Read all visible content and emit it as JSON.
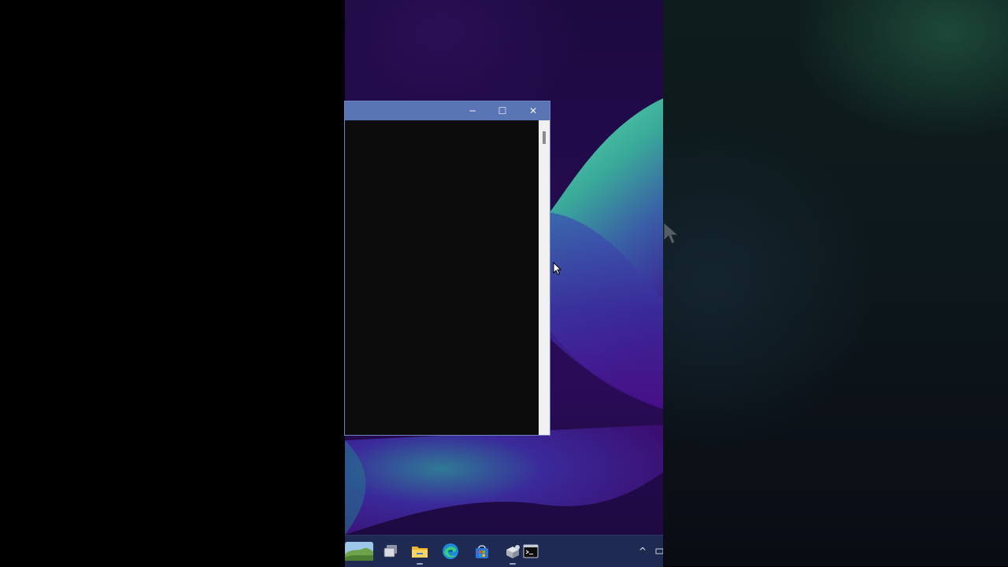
{
  "window": {
    "title": "",
    "minimize_glyph": "─",
    "maximize_glyph": "☐",
    "close_glyph": "✕",
    "console_text": ""
  },
  "taskbar": {
    "items": [
      {
        "name": "widgets",
        "icon": "landscape-icon"
      },
      {
        "name": "task-view",
        "icon": "task-view-icon"
      },
      {
        "name": "file-explorer",
        "icon": "folder-icon",
        "running": true
      },
      {
        "name": "edge",
        "icon": "edge-icon"
      },
      {
        "name": "store",
        "icon": "store-icon"
      },
      {
        "name": "installer",
        "icon": "installer-icon",
        "running": true
      },
      {
        "name": "terminal",
        "icon": "terminal-icon",
        "running": true
      }
    ],
    "tray_chevron": "^"
  },
  "colors": {
    "titlebar": "#5a75b3",
    "console_bg": "#0c0c0c",
    "taskbar": "#1e2a52",
    "wallpaper_green": "#4fd5a0",
    "wallpaper_purple": "#2a0b58"
  }
}
